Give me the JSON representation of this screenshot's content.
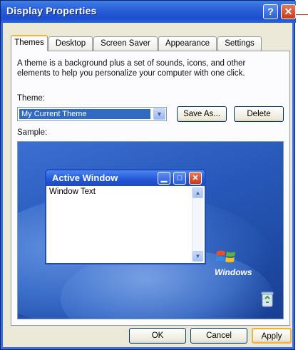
{
  "window": {
    "title": "Display Properties",
    "help_label": "?",
    "close_label": "✕"
  },
  "tabs": [
    {
      "label": "Themes",
      "active": true
    },
    {
      "label": "Desktop",
      "active": false
    },
    {
      "label": "Screen Saver",
      "active": false
    },
    {
      "label": "Appearance",
      "active": false
    },
    {
      "label": "Settings",
      "active": false
    }
  ],
  "themes": {
    "description": "A theme is a background plus a set of sounds, icons, and other elements to help you personalize your computer with one click.",
    "theme_label": "Theme:",
    "theme_value": "My Current Theme",
    "save_as_label": "Save As...",
    "delete_label": "Delete",
    "sample_label": "Sample:"
  },
  "sample": {
    "active_window_title": "Active Window",
    "window_text": "Window Text",
    "windows_brand": "Windows"
  },
  "footer": {
    "ok_label": "OK",
    "cancel_label": "Cancel",
    "apply_label": "Apply"
  },
  "colors": {
    "titlebar": "#2a5fd8",
    "selection": "#316ac5",
    "close": "#c43b1a"
  }
}
